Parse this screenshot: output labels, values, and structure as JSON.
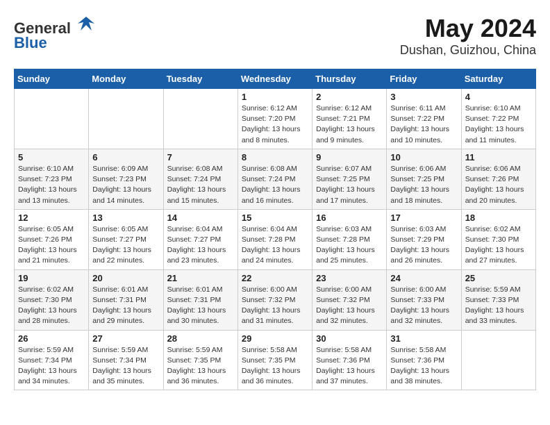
{
  "header": {
    "logo_general": "General",
    "logo_blue": "Blue",
    "title": "May 2024",
    "subtitle": "Dushan, Guizhou, China"
  },
  "weekdays": [
    "Sunday",
    "Monday",
    "Tuesday",
    "Wednesday",
    "Thursday",
    "Friday",
    "Saturday"
  ],
  "weeks": [
    [
      {
        "day": "",
        "info": ""
      },
      {
        "day": "",
        "info": ""
      },
      {
        "day": "",
        "info": ""
      },
      {
        "day": "1",
        "info": "Sunrise: 6:12 AM\nSunset: 7:20 PM\nDaylight: 13 hours and 8 minutes."
      },
      {
        "day": "2",
        "info": "Sunrise: 6:12 AM\nSunset: 7:21 PM\nDaylight: 13 hours and 9 minutes."
      },
      {
        "day": "3",
        "info": "Sunrise: 6:11 AM\nSunset: 7:22 PM\nDaylight: 13 hours and 10 minutes."
      },
      {
        "day": "4",
        "info": "Sunrise: 6:10 AM\nSunset: 7:22 PM\nDaylight: 13 hours and 11 minutes."
      }
    ],
    [
      {
        "day": "5",
        "info": "Sunrise: 6:10 AM\nSunset: 7:23 PM\nDaylight: 13 hours and 13 minutes."
      },
      {
        "day": "6",
        "info": "Sunrise: 6:09 AM\nSunset: 7:23 PM\nDaylight: 13 hours and 14 minutes."
      },
      {
        "day": "7",
        "info": "Sunrise: 6:08 AM\nSunset: 7:24 PM\nDaylight: 13 hours and 15 minutes."
      },
      {
        "day": "8",
        "info": "Sunrise: 6:08 AM\nSunset: 7:24 PM\nDaylight: 13 hours and 16 minutes."
      },
      {
        "day": "9",
        "info": "Sunrise: 6:07 AM\nSunset: 7:25 PM\nDaylight: 13 hours and 17 minutes."
      },
      {
        "day": "10",
        "info": "Sunrise: 6:06 AM\nSunset: 7:25 PM\nDaylight: 13 hours and 18 minutes."
      },
      {
        "day": "11",
        "info": "Sunrise: 6:06 AM\nSunset: 7:26 PM\nDaylight: 13 hours and 20 minutes."
      }
    ],
    [
      {
        "day": "12",
        "info": "Sunrise: 6:05 AM\nSunset: 7:26 PM\nDaylight: 13 hours and 21 minutes."
      },
      {
        "day": "13",
        "info": "Sunrise: 6:05 AM\nSunset: 7:27 PM\nDaylight: 13 hours and 22 minutes."
      },
      {
        "day": "14",
        "info": "Sunrise: 6:04 AM\nSunset: 7:27 PM\nDaylight: 13 hours and 23 minutes."
      },
      {
        "day": "15",
        "info": "Sunrise: 6:04 AM\nSunset: 7:28 PM\nDaylight: 13 hours and 24 minutes."
      },
      {
        "day": "16",
        "info": "Sunrise: 6:03 AM\nSunset: 7:28 PM\nDaylight: 13 hours and 25 minutes."
      },
      {
        "day": "17",
        "info": "Sunrise: 6:03 AM\nSunset: 7:29 PM\nDaylight: 13 hours and 26 minutes."
      },
      {
        "day": "18",
        "info": "Sunrise: 6:02 AM\nSunset: 7:30 PM\nDaylight: 13 hours and 27 minutes."
      }
    ],
    [
      {
        "day": "19",
        "info": "Sunrise: 6:02 AM\nSunset: 7:30 PM\nDaylight: 13 hours and 28 minutes."
      },
      {
        "day": "20",
        "info": "Sunrise: 6:01 AM\nSunset: 7:31 PM\nDaylight: 13 hours and 29 minutes."
      },
      {
        "day": "21",
        "info": "Sunrise: 6:01 AM\nSunset: 7:31 PM\nDaylight: 13 hours and 30 minutes."
      },
      {
        "day": "22",
        "info": "Sunrise: 6:00 AM\nSunset: 7:32 PM\nDaylight: 13 hours and 31 minutes."
      },
      {
        "day": "23",
        "info": "Sunrise: 6:00 AM\nSunset: 7:32 PM\nDaylight: 13 hours and 32 minutes."
      },
      {
        "day": "24",
        "info": "Sunrise: 6:00 AM\nSunset: 7:33 PM\nDaylight: 13 hours and 32 minutes."
      },
      {
        "day": "25",
        "info": "Sunrise: 5:59 AM\nSunset: 7:33 PM\nDaylight: 13 hours and 33 minutes."
      }
    ],
    [
      {
        "day": "26",
        "info": "Sunrise: 5:59 AM\nSunset: 7:34 PM\nDaylight: 13 hours and 34 minutes."
      },
      {
        "day": "27",
        "info": "Sunrise: 5:59 AM\nSunset: 7:34 PM\nDaylight: 13 hours and 35 minutes."
      },
      {
        "day": "28",
        "info": "Sunrise: 5:59 AM\nSunset: 7:35 PM\nDaylight: 13 hours and 36 minutes."
      },
      {
        "day": "29",
        "info": "Sunrise: 5:58 AM\nSunset: 7:35 PM\nDaylight: 13 hours and 36 minutes."
      },
      {
        "day": "30",
        "info": "Sunrise: 5:58 AM\nSunset: 7:36 PM\nDaylight: 13 hours and 37 minutes."
      },
      {
        "day": "31",
        "info": "Sunrise: 5:58 AM\nSunset: 7:36 PM\nDaylight: 13 hours and 38 minutes."
      },
      {
        "day": "",
        "info": ""
      }
    ]
  ]
}
